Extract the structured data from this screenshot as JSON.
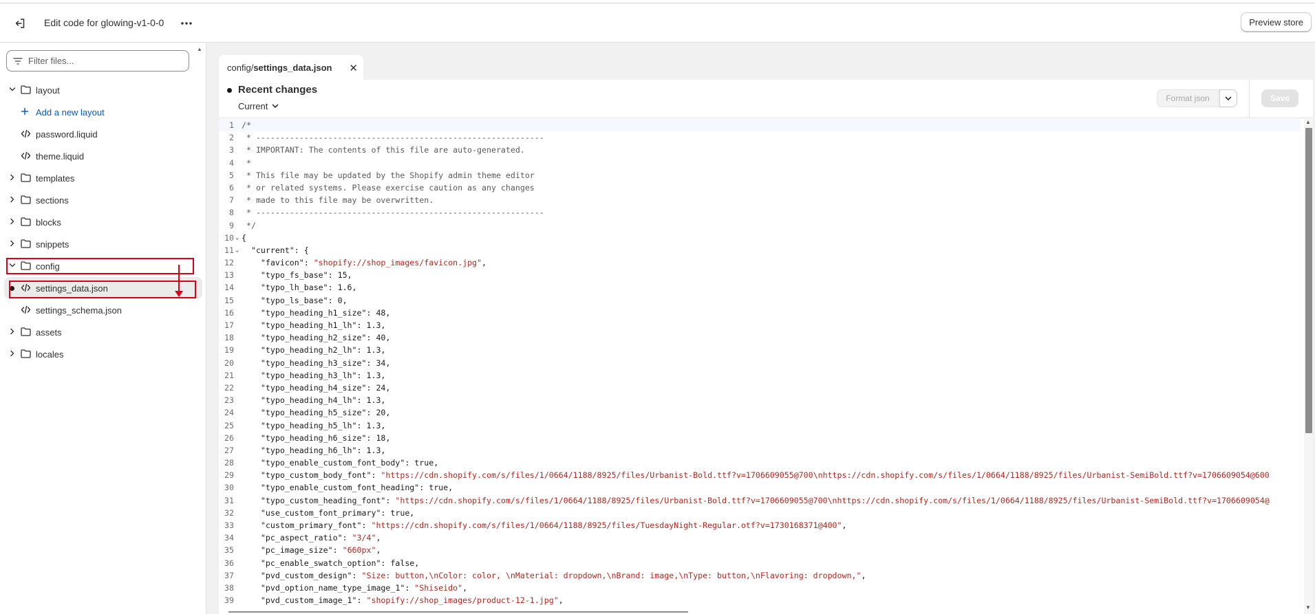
{
  "header": {
    "title": "Edit code for glowing-v1-0-0",
    "preview_label": "Preview store"
  },
  "sidebar": {
    "filter_placeholder": "Filter files...",
    "items": [
      {
        "label": "layout",
        "type": "folder",
        "expanded": true
      },
      {
        "label": "Add a new layout",
        "type": "add"
      },
      {
        "label": "password.liquid",
        "type": "file"
      },
      {
        "label": "theme.liquid",
        "type": "file"
      },
      {
        "label": "templates",
        "type": "folder",
        "expanded": false
      },
      {
        "label": "sections",
        "type": "folder",
        "expanded": false
      },
      {
        "label": "blocks",
        "type": "folder",
        "expanded": false
      },
      {
        "label": "snippets",
        "type": "folder",
        "expanded": false
      },
      {
        "label": "config",
        "type": "folder",
        "expanded": true
      },
      {
        "label": "settings_data.json",
        "type": "file",
        "selected": true,
        "modified": true
      },
      {
        "label": "settings_schema.json",
        "type": "file"
      },
      {
        "label": "assets",
        "type": "folder",
        "expanded": false
      },
      {
        "label": "locales",
        "type": "folder",
        "expanded": false
      }
    ]
  },
  "tab": {
    "path": "config/",
    "filename": "settings_data.json"
  },
  "editor": {
    "changes_title": "Recent changes",
    "version_label": "Current",
    "format_label": "Format json",
    "save_label": "Save",
    "lines": [
      {
        "n": "1",
        "text": "/*"
      },
      {
        "n": "2",
        "text": " * ------------------------------------------------------------"
      },
      {
        "n": "3",
        "text": " * IMPORTANT: The contents of this file are auto-generated."
      },
      {
        "n": "4",
        "text": " *"
      },
      {
        "n": "5",
        "text": " * This file may be updated by the Shopify admin theme editor"
      },
      {
        "n": "6",
        "text": " * or related systems. Please exercise caution as any changes"
      },
      {
        "n": "7",
        "text": " * made to this file may be overwritten."
      },
      {
        "n": "8",
        "text": " * ------------------------------------------------------------"
      },
      {
        "n": "9",
        "text": " */"
      },
      {
        "n": "10",
        "text": "{",
        "fold": true
      },
      {
        "n": "11",
        "text": "  \"current\": {",
        "fold": true
      },
      {
        "n": "12",
        "key": "    \"favicon\": ",
        "val": "\"shopify://shop_images/favicon.jpg\"",
        "tail": ","
      },
      {
        "n": "13",
        "key": "    \"typo_fs_base\": 15,"
      },
      {
        "n": "14",
        "key": "    \"typo_lh_base\": 1.6,"
      },
      {
        "n": "15",
        "key": "    \"typo_ls_base\": 0,"
      },
      {
        "n": "16",
        "key": "    \"typo_heading_h1_size\": 48,"
      },
      {
        "n": "17",
        "key": "    \"typo_heading_h1_lh\": 1.3,"
      },
      {
        "n": "18",
        "key": "    \"typo_heading_h2_size\": 40,"
      },
      {
        "n": "19",
        "key": "    \"typo_heading_h2_lh\": 1.3,"
      },
      {
        "n": "20",
        "key": "    \"typo_heading_h3_size\": 34,"
      },
      {
        "n": "21",
        "key": "    \"typo_heading_h3_lh\": 1.3,"
      },
      {
        "n": "22",
        "key": "    \"typo_heading_h4_size\": 24,"
      },
      {
        "n": "23",
        "key": "    \"typo_heading_h4_lh\": 1.3,"
      },
      {
        "n": "24",
        "key": "    \"typo_heading_h5_size\": 20,"
      },
      {
        "n": "25",
        "key": "    \"typo_heading_h5_lh\": 1.3,"
      },
      {
        "n": "26",
        "key": "    \"typo_heading_h6_size\": 18,"
      },
      {
        "n": "27",
        "key": "    \"typo_heading_h6_lh\": 1.3,"
      },
      {
        "n": "28",
        "key": "    \"typo_enable_custom_font_body\": true,"
      },
      {
        "n": "29",
        "key": "    \"typo_custom_body_font\": ",
        "val": "\"https://cdn.shopify.com/s/files/1/0664/1188/8925/files/Urbanist-Bold.ttf?v=1706609055@700\\nhttps://cdn.shopify.com/s/files/1/0664/1188/8925/files/Urbanist-SemiBold.ttf?v=1706609054@600",
        "tail": ""
      },
      {
        "n": "30",
        "key": "    \"typo_enable_custom_font_heading\": true,"
      },
      {
        "n": "31",
        "key": "    \"typo_custom_heading_font\": ",
        "val": "\"https://cdn.shopify.com/s/files/1/0664/1188/8925/files/Urbanist-Bold.ttf?v=1706609055@700\\nhttps://cdn.shopify.com/s/files/1/0664/1188/8925/files/Urbanist-SemiBold.ttf?v=1706609054@",
        "tail": ""
      },
      {
        "n": "32",
        "key": "    \"use_custom_font_primary\": true,"
      },
      {
        "n": "33",
        "key": "    \"custom_primary_font\": ",
        "val": "\"https://cdn.shopify.com/s/files/1/0664/1188/8925/files/TuesdayNight-Regular.otf?v=1730168371@400\"",
        "tail": ","
      },
      {
        "n": "34",
        "key": "    \"pc_aspect_ratio\": ",
        "val": "\"3/4\"",
        "tail": ","
      },
      {
        "n": "35",
        "key": "    \"pc_image_size\": ",
        "val": "\"660px\"",
        "tail": ","
      },
      {
        "n": "36",
        "key": "    \"pc_enable_swatch_option\": false,"
      },
      {
        "n": "37",
        "key": "    \"pvd_custom_design\": ",
        "val": "\"Size: button,\\nColor: color, \\nMaterial: dropdown,\\nBrand: image,\\nType: button,\\nFlavoring: dropdown,\"",
        "tail": ","
      },
      {
        "n": "38",
        "key": "    \"pvd_option_name_type_image_1\": ",
        "val": "\"Shiseido\"",
        "tail": ","
      },
      {
        "n": "39",
        "key": "    \"pvd_custom_image_1\": ",
        "val": "\"shopify://shop_images/product-12-1.jpg\"",
        "tail": ","
      }
    ]
  },
  "colors": {
    "annotation": "#d9001b",
    "string": "#b3261e",
    "link": "#005bd3"
  }
}
